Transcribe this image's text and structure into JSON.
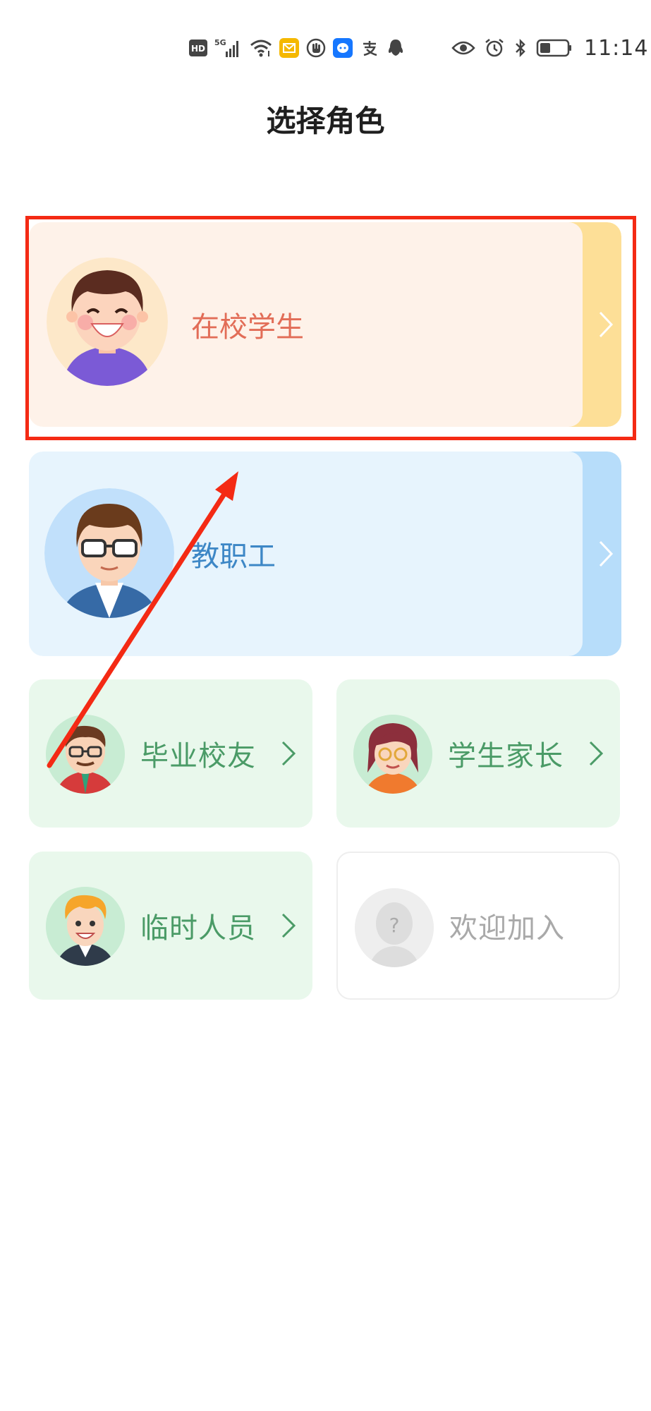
{
  "status_bar": {
    "time": "11:14",
    "network": "5G",
    "hd_badge": "HD",
    "icons": [
      "hd-icon",
      "signal-5g-icon",
      "wifi-icon",
      "mail-app-icon",
      "hand-icon",
      "chat-app-icon",
      "alipay-icon",
      "qq-icon",
      "eye-icon",
      "alarm-icon",
      "bluetooth-icon",
      "battery-icon"
    ]
  },
  "page": {
    "title": "选择角色"
  },
  "roles": {
    "student": {
      "label": "在校学生",
      "icon": "student-avatar-icon"
    },
    "staff": {
      "label": "教职工",
      "icon": "teacher-avatar-icon"
    },
    "alumni": {
      "label": "毕业校友",
      "icon": "alumni-avatar-icon"
    },
    "parent": {
      "label": "学生家长",
      "icon": "parent-avatar-icon"
    },
    "temp": {
      "label": "临时人员",
      "icon": "temp-staff-avatar-icon"
    },
    "welcome": {
      "label": "欢迎加入",
      "icon": "unknown-person-icon"
    }
  },
  "colors": {
    "student_bg": "#fef2e9",
    "student_tab": "#fddf97",
    "student_text": "#e26d57",
    "staff_bg": "#e7f4fd",
    "staff_tab": "#b7ddfa",
    "staff_text": "#3d87c6",
    "small_bg": "#e9f8ec",
    "small_text": "#4b9b67",
    "annotation_red": "#f42a14"
  }
}
